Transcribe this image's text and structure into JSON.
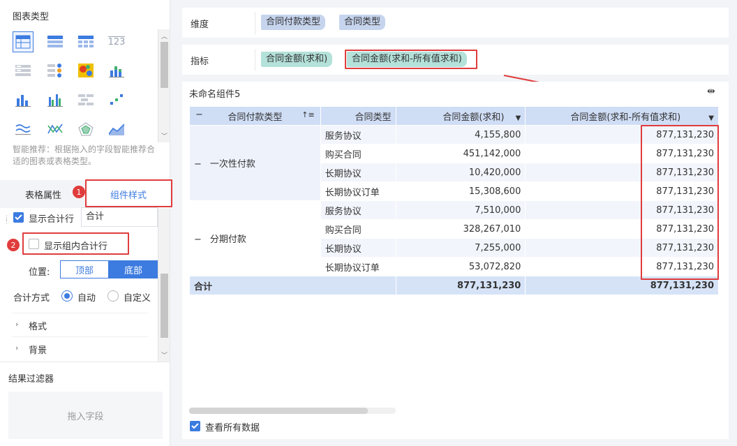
{
  "left": {
    "chart_type_title": "图表类型",
    "chart_icons": [
      "table-icon",
      "crosstab-icon",
      "detail-table-icon",
      "kpi-number-icon",
      "list-icon",
      "dot-list-icon",
      "heatmap-icon",
      "stacked-bar-icon",
      "bar-chart-icon",
      "grouped-bar-icon",
      "waterfall-icon",
      "scatter-icon",
      "line-wave-icon",
      "line-cross-icon",
      "radar-icon",
      "area-chart-icon"
    ],
    "kpi_icon_text": "123",
    "smart_tip": "智能推荐：根据拖入的字段智能推荐合适的图表或表格类型。",
    "tab_props": "表格属性",
    "tab_style": "组件样式",
    "badge1": "1",
    "badge2": "2",
    "show_total_label": "显示合计行",
    "total_input_value": "合计",
    "show_group_total_label": "显示组内合计行",
    "position_label": "位置:",
    "pos_top": "顶部",
    "pos_bottom": "底部",
    "calc_label": "合计方式",
    "calc_auto": "自动",
    "calc_custom": "自定义",
    "format_label": "格式",
    "background_label": "背景",
    "filter_title": "结果过滤器",
    "drop_field": "拖入字段"
  },
  "top": {
    "dim_label": "维度",
    "dim_pills": [
      "合同付款类型",
      "合同类型"
    ],
    "metric_label": "指标",
    "metric_pills": [
      "合同金额(求和)",
      "合同金额(求和-所有值求和)"
    ]
  },
  "widget": {
    "title": "未命名组件5",
    "headers": [
      "合同付款类型",
      "合同类型",
      "合同金额(求和)",
      "合同金额(求和-所有值求和)"
    ],
    "collapse_symbol": "−",
    "groups": [
      {
        "name": "一次性付款",
        "rows": [
          {
            "type": "服务协议",
            "amount": "4,155,800",
            "total": "877,131,230"
          },
          {
            "type": "购买合同",
            "amount": "451,142,000",
            "total": "877,131,230"
          },
          {
            "type": "长期协议",
            "amount": "10,420,000",
            "total": "877,131,230"
          },
          {
            "type": "长期协议订单",
            "amount": "15,308,600",
            "total": "877,131,230"
          }
        ]
      },
      {
        "name": "分期付款",
        "rows": [
          {
            "type": "服务协议",
            "amount": "7,510,000",
            "total": "877,131,230"
          },
          {
            "type": "购买合同",
            "amount": "328,267,010",
            "total": "877,131,230"
          },
          {
            "type": "长期协议",
            "amount": "7,255,000",
            "total": "877,131,230"
          },
          {
            "type": "长期协议订单",
            "amount": "53,072,820",
            "total": "877,131,230"
          }
        ]
      }
    ],
    "total_label": "合计",
    "total_amount": "877,131,230",
    "total_all": "877,131,230",
    "view_all_label": "查看所有数据"
  },
  "colors": {
    "accent": "#3c7be0",
    "highlight": "#e03c3c"
  }
}
